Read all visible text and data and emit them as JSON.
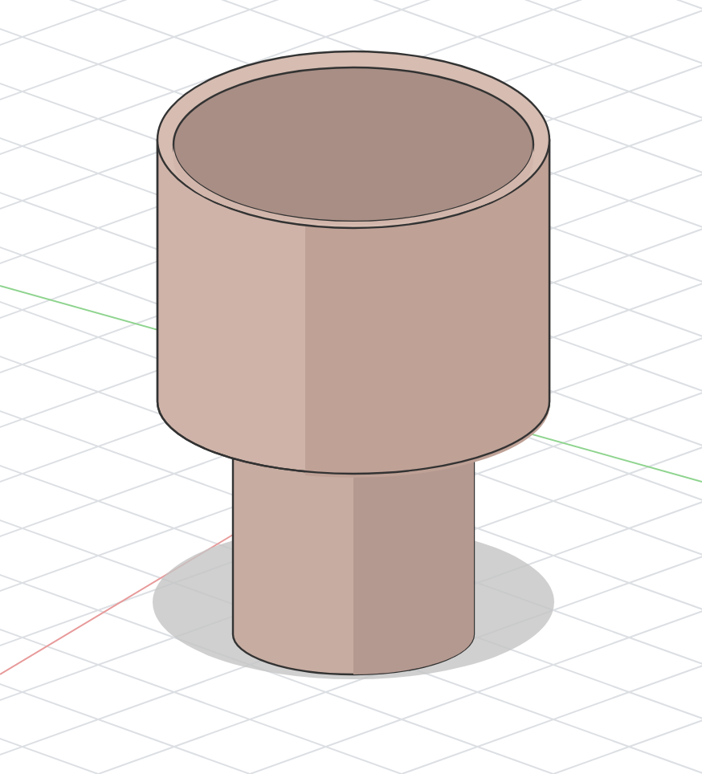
{
  "viewport": {
    "grid": true,
    "shadow": true
  }
}
